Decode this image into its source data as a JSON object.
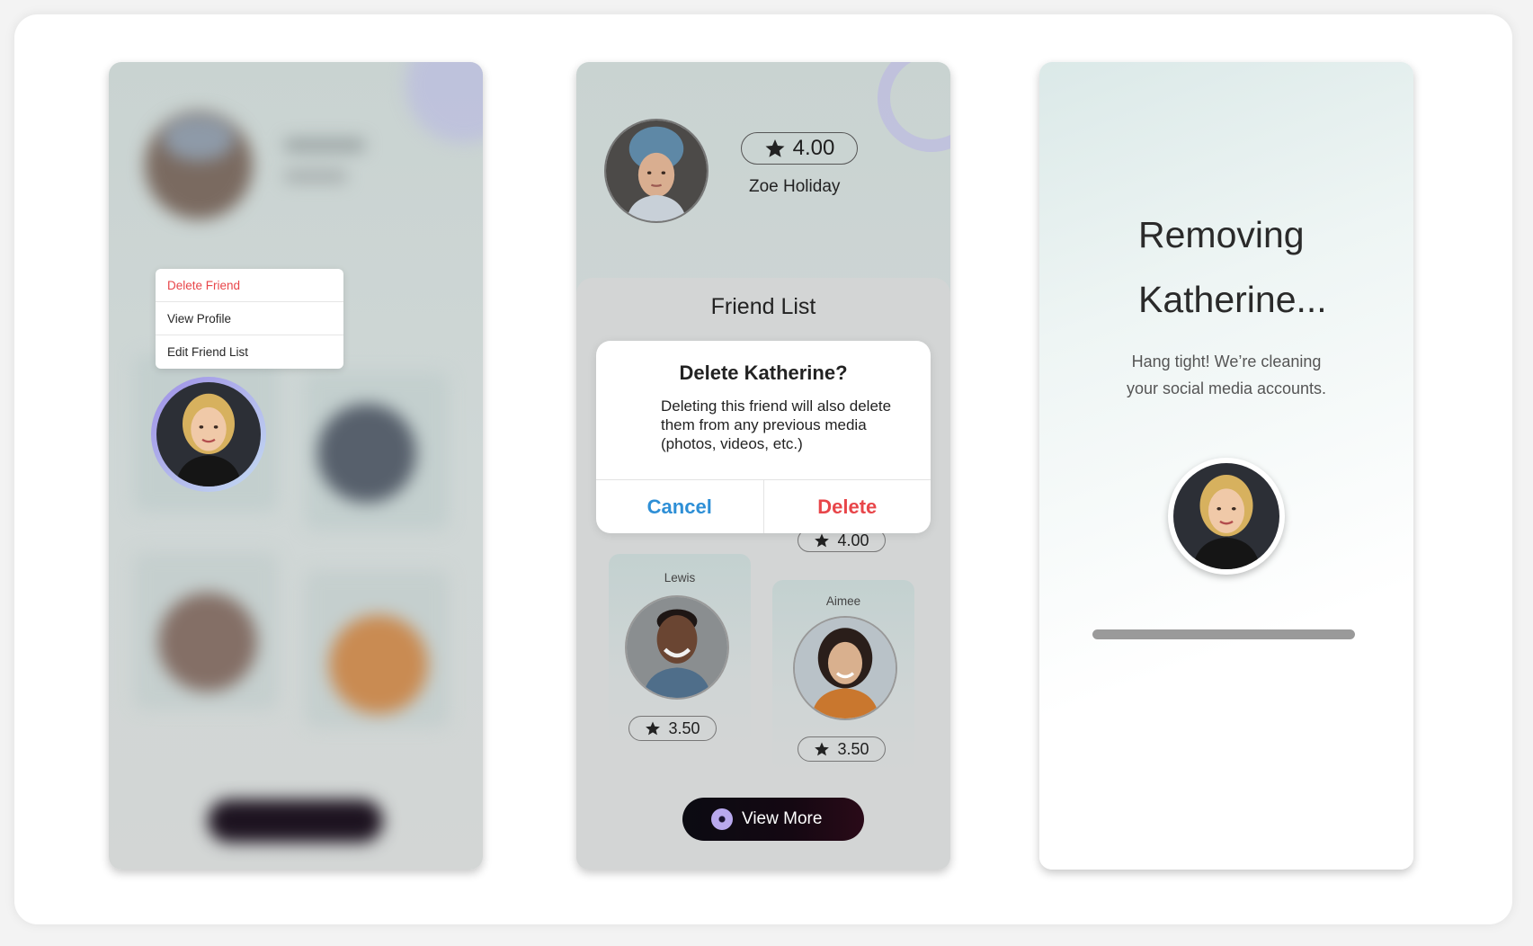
{
  "context_menu": {
    "delete_friend": "Delete Friend",
    "view_profile": "View Profile",
    "edit_friend_list": "Edit Friend List"
  },
  "profile": {
    "rating": "4.00",
    "name": "Zoe Holiday"
  },
  "friend_list": {
    "title": "Friend List",
    "friends": [
      {
        "name": "Lewis",
        "rating": "3.50"
      },
      {
        "name": "Aimee",
        "rating": "3.50"
      }
    ],
    "hidden_card_rating": "4.00"
  },
  "dialog": {
    "title": "Delete Katherine?",
    "body": "Deleting this friend will also delete them from any previous media (photos, videos, etc.)",
    "cancel": "Cancel",
    "delete": "Delete"
  },
  "view_more": "View More",
  "removing": {
    "title_line1": "Removing",
    "title_line2": "Katherine...",
    "subtitle_line1": "Hang tight! We’re cleaning",
    "subtitle_line2": "your social media accounts.",
    "progress": 1.0
  },
  "colors": {
    "danger": "#e8464a",
    "link": "#2e8fd6",
    "accent": "#b9a9ee"
  },
  "icons": [
    "star-icon",
    "disc-icon"
  ]
}
